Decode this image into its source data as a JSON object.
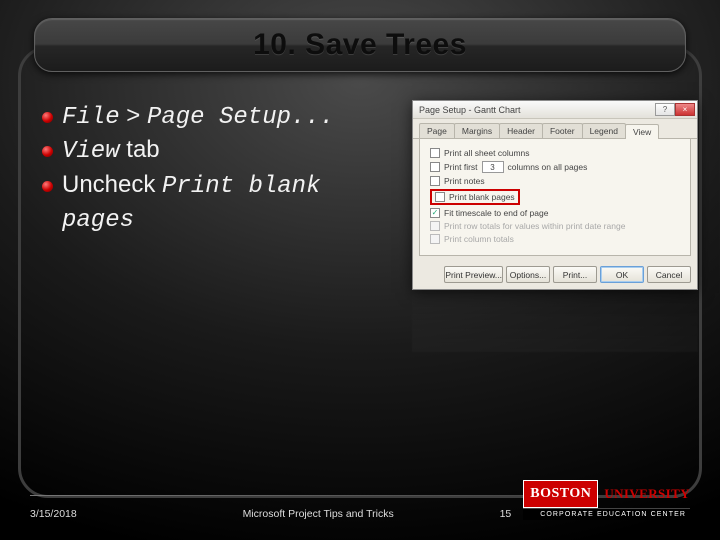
{
  "title": "10. Save Trees",
  "bullets": [
    {
      "code1": "File",
      "plain1": " > ",
      "code2": "Page Setup..."
    },
    {
      "code1": "View",
      "plain1": " tab"
    },
    {
      "plain1": "Uncheck ",
      "code1": "Print blank pages"
    }
  ],
  "dialog": {
    "title": "Page Setup - Gantt Chart",
    "tabs": [
      "Page",
      "Margins",
      "Header",
      "Footer",
      "Legend",
      "View"
    ],
    "rows": {
      "print_all_sheet_columns": "Print all sheet columns",
      "print_first_a": "Print first",
      "first_columns_value": "3",
      "print_first_b": "columns on all pages",
      "print_notes": "Print notes",
      "print_blank_pages": "Print blank pages",
      "fit_timescale": "Fit timescale to end of page",
      "print_row_totals": "Print row totals for values within print date range",
      "print_column_totals": "Print column totals"
    },
    "buttons": [
      "Print Preview...",
      "Options...",
      "Print...",
      "OK",
      "Cancel"
    ]
  },
  "footer": {
    "date": "3/15/2018",
    "center": "Microsoft Project Tips and Tricks",
    "page": "15"
  },
  "logo": {
    "boston": "BOSTON",
    "university": "UNIVERSITY",
    "sub": "CORPORATE EDUCATION CENTER"
  }
}
